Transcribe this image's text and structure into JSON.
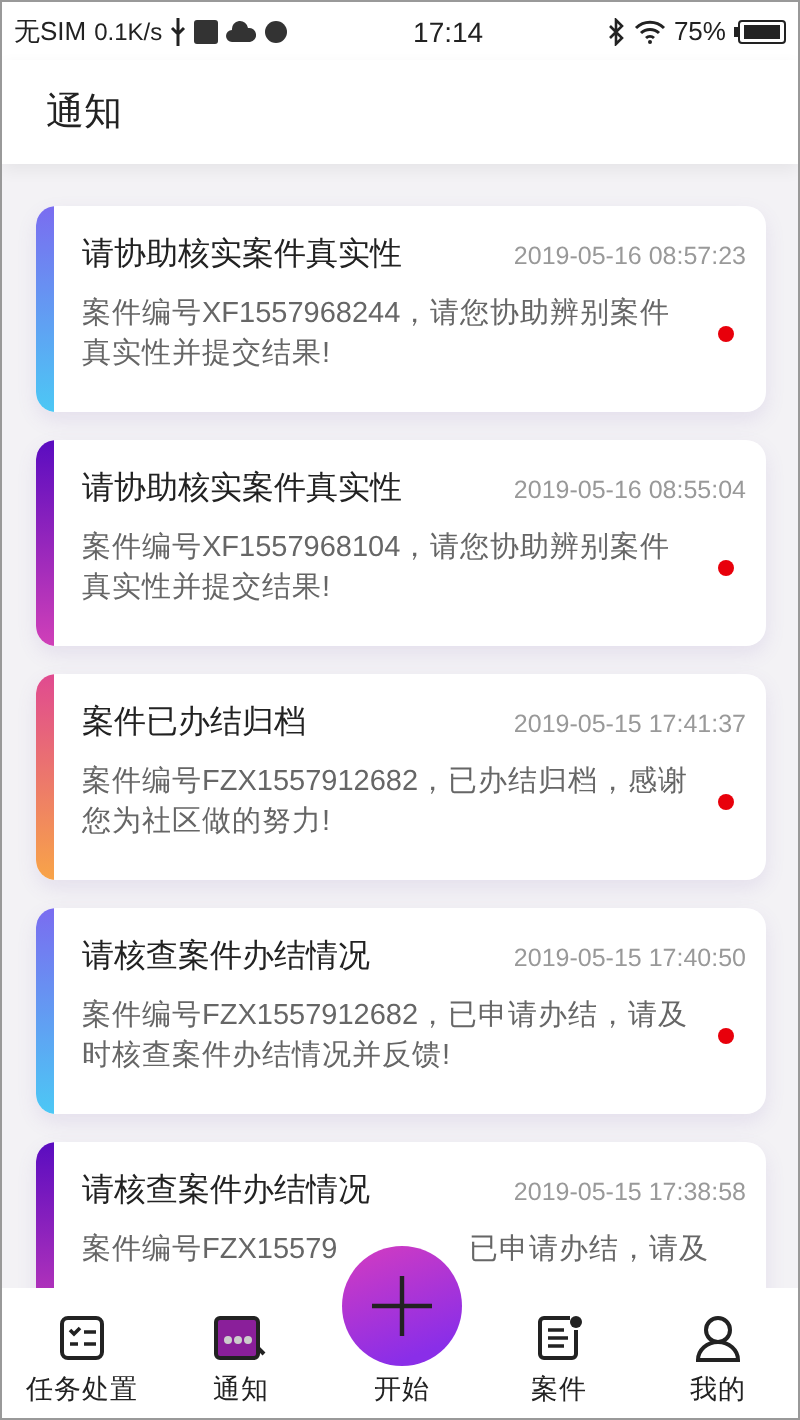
{
  "status_bar": {
    "carrier": "无SIM",
    "speed": "0.1K/s",
    "time": "17:14",
    "battery": "75%"
  },
  "header": {
    "title": "通知"
  },
  "notifications": [
    {
      "title": "请协助核实案件真实性",
      "time": "2019-05-16 08:57:23",
      "body": [
        "案件编号XF1557968244，请您协助辨别案件真实性并提交结果!"
      ],
      "kind": "sky",
      "unread": true
    },
    {
      "title": "请协助核实案件真实性",
      "time": "2019-05-16 08:55:04",
      "body": [
        "案件编号XF1557968104，请您协助辨别案件真实性并提交结果!"
      ],
      "kind": "violet",
      "unread": true
    },
    {
      "title": "案件已办结归档",
      "time": "2019-05-15 17:41:37",
      "body": [
        "案件编号FZX1557912682，已办结归档，感谢您为社区做的努力!"
      ],
      "kind": "sunset",
      "unread": true
    },
    {
      "title": "请核查案件办结情况",
      "time": "2019-05-15 17:40:50",
      "body": [
        "案件编号FZX1557912682，已申请办结，请及时核查案件办结情况并反馈!"
      ],
      "kind": "sky",
      "unread": true
    },
    {
      "title": "请核查案件办结情况",
      "time": "2019-05-15 17:38:58",
      "body": [
        "案件编号FZX15579",
        "已申请办结，请及"
      ],
      "kind": "violet",
      "unread": false
    }
  ],
  "nav": [
    {
      "label": "任务处置",
      "kind": "tasks",
      "selected": false
    },
    {
      "label": "通知",
      "kind": "notice",
      "selected": true
    },
    {
      "label": "案件",
      "kind": "cases",
      "selected": false
    },
    {
      "label": "我的",
      "kind": "me",
      "selected": false
    }
  ],
  "start_button": {
    "label": "开始"
  }
}
